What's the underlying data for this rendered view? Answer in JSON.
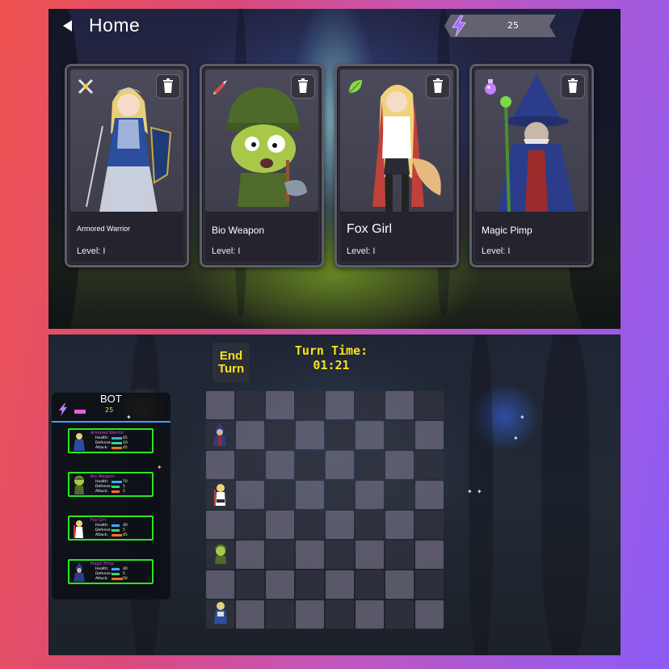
{
  "top": {
    "title": "Home",
    "energy": "25",
    "cards": [
      {
        "name": "Armored Warrior",
        "level": "Level: I",
        "class_icon": "sword-icon"
      },
      {
        "name": "Bio Weapon",
        "level": "Level: I",
        "class_icon": "missile-icon"
      },
      {
        "name": "Fox Girl",
        "level": "Level: I",
        "class_icon": "leaf-icon"
      },
      {
        "name": "Magic Pimp",
        "level": "Level: I",
        "class_icon": "potion-icon"
      }
    ],
    "delete_icon": "trash-icon"
  },
  "bottom": {
    "end_turn": "End Turn",
    "turn_time_label": "Turn Time:",
    "turn_time_value": "01:21",
    "bot": {
      "title": "BOT",
      "energy": "25",
      "units": [
        {
          "name": "Armored Warrior",
          "health": "65",
          "defense": "10",
          "attack": "45"
        },
        {
          "name": "Bio Weapon",
          "health": "70",
          "defense": "5",
          "attack": "5"
        },
        {
          "name": "Fox Girl",
          "health": "40",
          "defense": "5",
          "attack": "45"
        },
        {
          "name": "Magic Pimp",
          "health": "40",
          "defense": "5",
          "attack": "50"
        }
      ],
      "stat_labels": {
        "health": "Health:",
        "defense": "Defense:",
        "attack": "Attack:"
      }
    },
    "colors": {
      "accent_yellow": "#f7e21c",
      "health_bar": "#3fa7ff",
      "defense_bar": "#36d67a",
      "attack_bar": "#ff6a2a",
      "unit_border": "#27e81f",
      "energy": "#e35de1"
    }
  }
}
